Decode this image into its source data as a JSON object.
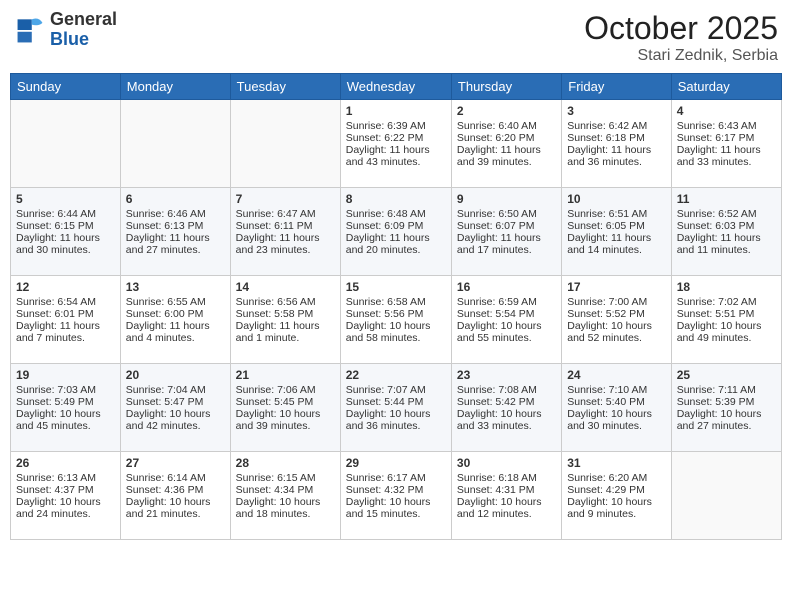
{
  "header": {
    "logo": {
      "general": "General",
      "blue": "Blue"
    },
    "title": "October 2025",
    "subtitle": "Stari Zednik, Serbia"
  },
  "weekdays": [
    "Sunday",
    "Monday",
    "Tuesday",
    "Wednesday",
    "Thursday",
    "Friday",
    "Saturday"
  ],
  "weeks": [
    [
      {
        "day": "",
        "info": ""
      },
      {
        "day": "",
        "info": ""
      },
      {
        "day": "",
        "info": ""
      },
      {
        "day": "1",
        "info": "Sunrise: 6:39 AM\nSunset: 6:22 PM\nDaylight: 11 hours\nand 43 minutes."
      },
      {
        "day": "2",
        "info": "Sunrise: 6:40 AM\nSunset: 6:20 PM\nDaylight: 11 hours\nand 39 minutes."
      },
      {
        "day": "3",
        "info": "Sunrise: 6:42 AM\nSunset: 6:18 PM\nDaylight: 11 hours\nand 36 minutes."
      },
      {
        "day": "4",
        "info": "Sunrise: 6:43 AM\nSunset: 6:17 PM\nDaylight: 11 hours\nand 33 minutes."
      }
    ],
    [
      {
        "day": "5",
        "info": "Sunrise: 6:44 AM\nSunset: 6:15 PM\nDaylight: 11 hours\nand 30 minutes."
      },
      {
        "day": "6",
        "info": "Sunrise: 6:46 AM\nSunset: 6:13 PM\nDaylight: 11 hours\nand 27 minutes."
      },
      {
        "day": "7",
        "info": "Sunrise: 6:47 AM\nSunset: 6:11 PM\nDaylight: 11 hours\nand 23 minutes."
      },
      {
        "day": "8",
        "info": "Sunrise: 6:48 AM\nSunset: 6:09 PM\nDaylight: 11 hours\nand 20 minutes."
      },
      {
        "day": "9",
        "info": "Sunrise: 6:50 AM\nSunset: 6:07 PM\nDaylight: 11 hours\nand 17 minutes."
      },
      {
        "day": "10",
        "info": "Sunrise: 6:51 AM\nSunset: 6:05 PM\nDaylight: 11 hours\nand 14 minutes."
      },
      {
        "day": "11",
        "info": "Sunrise: 6:52 AM\nSunset: 6:03 PM\nDaylight: 11 hours\nand 11 minutes."
      }
    ],
    [
      {
        "day": "12",
        "info": "Sunrise: 6:54 AM\nSunset: 6:01 PM\nDaylight: 11 hours\nand 7 minutes."
      },
      {
        "day": "13",
        "info": "Sunrise: 6:55 AM\nSunset: 6:00 PM\nDaylight: 11 hours\nand 4 minutes."
      },
      {
        "day": "14",
        "info": "Sunrise: 6:56 AM\nSunset: 5:58 PM\nDaylight: 11 hours\nand 1 minute."
      },
      {
        "day": "15",
        "info": "Sunrise: 6:58 AM\nSunset: 5:56 PM\nDaylight: 10 hours\nand 58 minutes."
      },
      {
        "day": "16",
        "info": "Sunrise: 6:59 AM\nSunset: 5:54 PM\nDaylight: 10 hours\nand 55 minutes."
      },
      {
        "day": "17",
        "info": "Sunrise: 7:00 AM\nSunset: 5:52 PM\nDaylight: 10 hours\nand 52 minutes."
      },
      {
        "day": "18",
        "info": "Sunrise: 7:02 AM\nSunset: 5:51 PM\nDaylight: 10 hours\nand 49 minutes."
      }
    ],
    [
      {
        "day": "19",
        "info": "Sunrise: 7:03 AM\nSunset: 5:49 PM\nDaylight: 10 hours\nand 45 minutes."
      },
      {
        "day": "20",
        "info": "Sunrise: 7:04 AM\nSunset: 5:47 PM\nDaylight: 10 hours\nand 42 minutes."
      },
      {
        "day": "21",
        "info": "Sunrise: 7:06 AM\nSunset: 5:45 PM\nDaylight: 10 hours\nand 39 minutes."
      },
      {
        "day": "22",
        "info": "Sunrise: 7:07 AM\nSunset: 5:44 PM\nDaylight: 10 hours\nand 36 minutes."
      },
      {
        "day": "23",
        "info": "Sunrise: 7:08 AM\nSunset: 5:42 PM\nDaylight: 10 hours\nand 33 minutes."
      },
      {
        "day": "24",
        "info": "Sunrise: 7:10 AM\nSunset: 5:40 PM\nDaylight: 10 hours\nand 30 minutes."
      },
      {
        "day": "25",
        "info": "Sunrise: 7:11 AM\nSunset: 5:39 PM\nDaylight: 10 hours\nand 27 minutes."
      }
    ],
    [
      {
        "day": "26",
        "info": "Sunrise: 6:13 AM\nSunset: 4:37 PM\nDaylight: 10 hours\nand 24 minutes."
      },
      {
        "day": "27",
        "info": "Sunrise: 6:14 AM\nSunset: 4:36 PM\nDaylight: 10 hours\nand 21 minutes."
      },
      {
        "day": "28",
        "info": "Sunrise: 6:15 AM\nSunset: 4:34 PM\nDaylight: 10 hours\nand 18 minutes."
      },
      {
        "day": "29",
        "info": "Sunrise: 6:17 AM\nSunset: 4:32 PM\nDaylight: 10 hours\nand 15 minutes."
      },
      {
        "day": "30",
        "info": "Sunrise: 6:18 AM\nSunset: 4:31 PM\nDaylight: 10 hours\nand 12 minutes."
      },
      {
        "day": "31",
        "info": "Sunrise: 6:20 AM\nSunset: 4:29 PM\nDaylight: 10 hours\nand 9 minutes."
      },
      {
        "day": "",
        "info": ""
      }
    ]
  ]
}
